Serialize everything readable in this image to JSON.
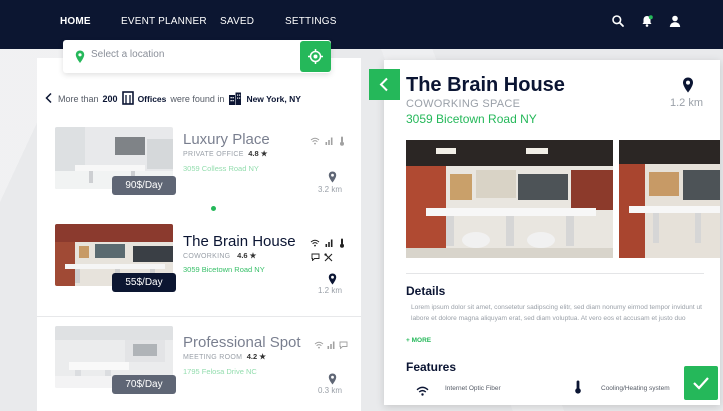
{
  "nav": {
    "items": [
      {
        "label": "HOME",
        "active": true
      },
      {
        "label": "EVENT PLANNER",
        "active": false
      },
      {
        "label": "SAVED",
        "active": false
      },
      {
        "label": "SETTINGS",
        "active": false
      }
    ],
    "icons": [
      "search-icon",
      "notification-bell-icon",
      "user-icon"
    ]
  },
  "search": {
    "placeholder": "Select a location",
    "value": ""
  },
  "results": {
    "prefix": "More than",
    "count": "200",
    "category": "Offices",
    "middle": "were found in",
    "city": "New York, NY"
  },
  "listings": [
    {
      "title": "Luxury Place",
      "type": "PRIVATE OFFICE",
      "rating": "4.8 ★",
      "address": "3059 Colless Road NY",
      "price": "90$/Day",
      "distance": "3.2 km",
      "amenities": [
        "wifi-icon",
        "signal-icon",
        "thermometer-icon"
      ]
    },
    {
      "title": "The Brain House",
      "type": "COWORKING",
      "rating": "4.6 ★",
      "address": "3059 Bicetown Road NY",
      "price": "55$/Day",
      "distance": "1.2 km",
      "amenities": [
        "wifi-icon",
        "signal-icon",
        "thermometer-icon",
        "chat-icon",
        "tools-icon"
      ]
    },
    {
      "title": "Professional Spot",
      "type": "MEETING ROOM",
      "rating": "4.2 ★",
      "address": "1795 Felosa Drive NC",
      "price": "70$/Day",
      "distance": "0.3 km",
      "amenities": [
        "wifi-icon",
        "signal-icon",
        "chat-icon"
      ]
    }
  ],
  "detail": {
    "title": "The Brain House",
    "type": "COWORKING SPACE",
    "address": "3059 Bicetown Road NY",
    "distance": "1.2 km",
    "details_heading": "Details",
    "details_text": "Lorem ipsum dolor sit amet, consetetur sadipscing elitr, sed diam nonumy eirmod tempor invidunt ut labore et dolore magna aliquyam erat, sed diam voluptua. At vero eos et accusam et justo duo",
    "more_label": "+ MORE",
    "features_heading": "Features",
    "features": [
      {
        "icon": "wifi-icon",
        "label": "Internet Optic Fiber"
      },
      {
        "icon": "thermometer-icon",
        "label": "Cooling/Heating system"
      }
    ]
  },
  "colors": {
    "navy": "#0c1631",
    "accent_green": "#25b85a",
    "price_active": "#0c1631",
    "price_inactive": "#5f6675"
  }
}
